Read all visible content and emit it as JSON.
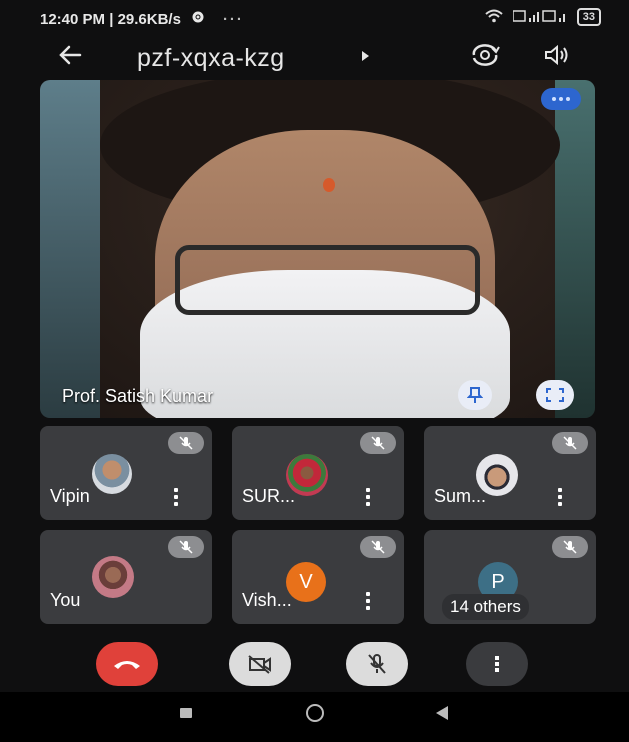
{
  "status_bar": {
    "time": "12:40 PM | 29.6KB/s",
    "battery": "33"
  },
  "header": {
    "meeting_code": "pzf-xqxa-kzg"
  },
  "main_video": {
    "speaker_name": "Prof. Satish Kumar"
  },
  "participants": [
    {
      "name": "Vipin",
      "avatar": "photo",
      "muted": true
    },
    {
      "name": "SUR...",
      "avatar": "photo",
      "muted": true
    },
    {
      "name": "Sum...",
      "avatar": "photo",
      "muted": true
    },
    {
      "name": "You",
      "avatar": "photo",
      "muted": true
    },
    {
      "name": "Vish...",
      "avatar_letter": "V",
      "avatar_color": "#e8711a",
      "muted": true
    },
    {
      "avatar_letter": "P",
      "avatar_color": "#3d6f86",
      "muted": true,
      "others_label": "14 others"
    }
  ],
  "colors": {
    "end_call": "#e0413a",
    "control_light": "#dcdcdc",
    "control_dark": "#3a3b3e",
    "tile_bg": "#3b3c3f"
  },
  "icons": [
    "settings-icon",
    "back-arrow-icon",
    "switch-camera-icon",
    "speaker-icon",
    "pin-icon",
    "fullscreen-icon",
    "mic-off-icon",
    "end-call-icon",
    "camera-off-icon",
    "more-vert-icon"
  ]
}
